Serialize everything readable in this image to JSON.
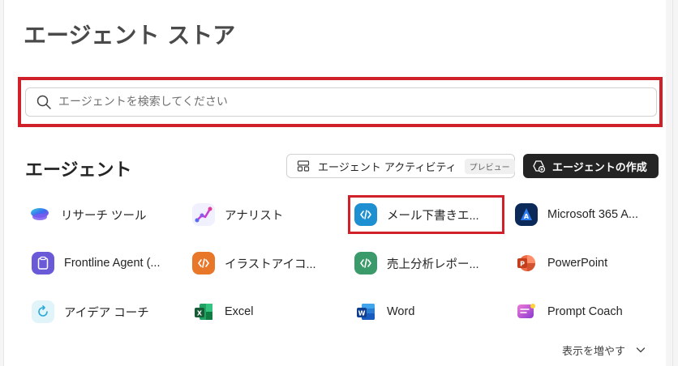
{
  "page": {
    "title": "エージェント ストア"
  },
  "search": {
    "placeholder": "エージェントを検索してください",
    "value": ""
  },
  "agents_section": {
    "title": "エージェント",
    "activity_button": {
      "label": "エージェント アクティビティ",
      "badge": "プレビュー"
    },
    "create_button": {
      "label": "エージェントの作成"
    },
    "items": [
      {
        "name": "リサーチ ツール",
        "icon": "researcher-icon"
      },
      {
        "name": "アナリスト",
        "icon": "analyst-icon"
      },
      {
        "name": "メール下書きエ...",
        "icon": "code-agent-icon"
      },
      {
        "name": "Microsoft 365 A...",
        "icon": "copilot-icon"
      },
      {
        "name": "Frontline Agent (...",
        "icon": "clipboard-icon"
      },
      {
        "name": "イラストアイコ...",
        "icon": "code-agent-icon"
      },
      {
        "name": "売上分析レポー...",
        "icon": "code-agent-icon"
      },
      {
        "name": "PowerPoint",
        "icon": "powerpoint-icon"
      },
      {
        "name": "アイデア コーチ",
        "icon": "idea-coach-icon"
      },
      {
        "name": "Excel",
        "icon": "excel-icon"
      },
      {
        "name": "Word",
        "icon": "word-icon"
      },
      {
        "name": "Prompt Coach",
        "icon": "prompt-coach-icon"
      }
    ],
    "show_more": {
      "label": "表示を増やす"
    }
  },
  "colors": {
    "highlight": "#d0202a",
    "primary_button": "#242424"
  }
}
